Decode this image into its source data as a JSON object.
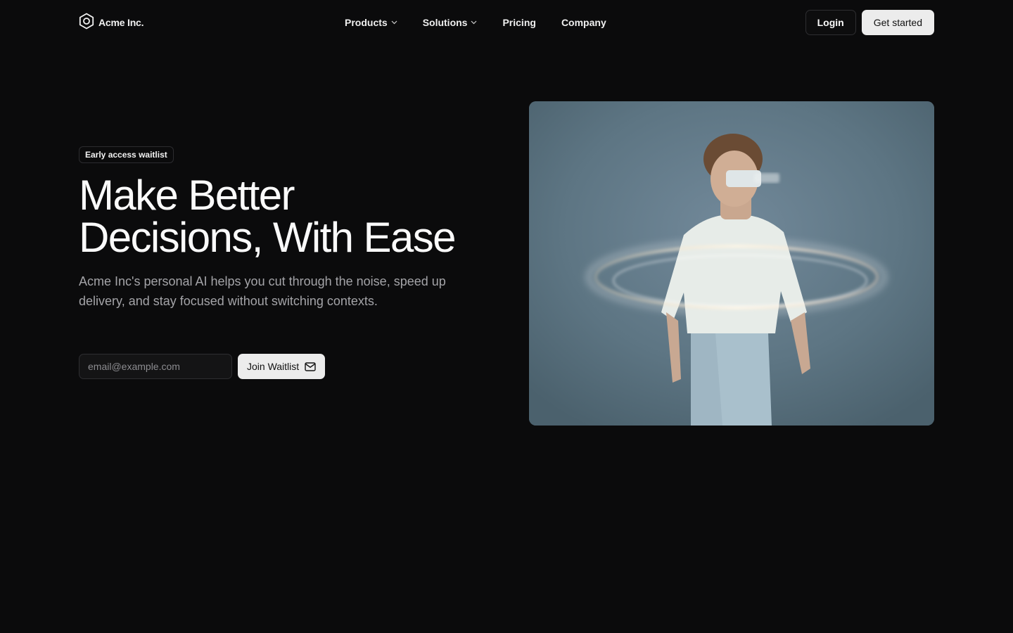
{
  "brand": {
    "name": "Acme Inc.",
    "icon": "hexagon-logo-icon"
  },
  "nav": {
    "links": [
      {
        "label": "Products",
        "dropdown": true
      },
      {
        "label": "Solutions",
        "dropdown": true
      },
      {
        "label": "Pricing",
        "dropdown": false
      },
      {
        "label": "Company",
        "dropdown": false
      }
    ],
    "login_label": "Login",
    "cta_label": "Get started"
  },
  "hero": {
    "badge": "Early access waitlist",
    "headline_line1": "Make Better",
    "headline_line2": "Decisions, With Ease",
    "subtitle": "Acme Inc's personal AI helps you cut through the noise, speed up delivery, and stay focused without switching contexts.",
    "email_placeholder": "email@example.com",
    "email_value": "",
    "join_label": "Join Waitlist",
    "join_icon": "mail-icon"
  },
  "colors": {
    "background": "#0b0b0c",
    "text": "#fafafa",
    "muted": "#a4a4a8",
    "button_light": "#ececec",
    "border": "#2e2e31"
  }
}
